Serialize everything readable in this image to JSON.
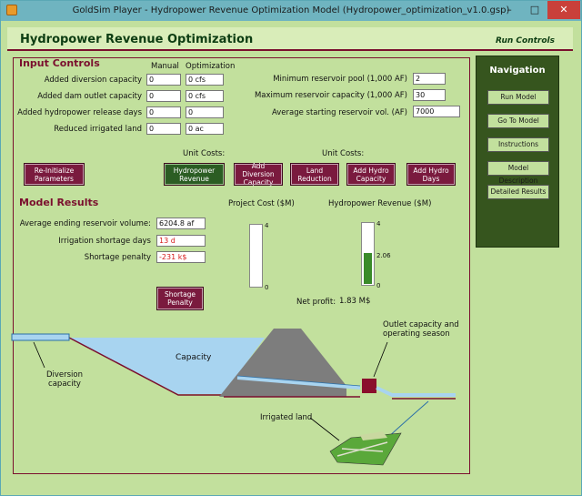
{
  "window": {
    "title": "GoldSim Player - Hydropower Revenue Optimization Model (Hydropower_optimization_v1.0.gsp)",
    "minimize": "–",
    "maximize": "□",
    "close": "✕"
  },
  "header": {
    "title": "Hydropower Revenue Optimization",
    "run_controls": "Run Controls"
  },
  "inputs": {
    "heading": "Input Controls",
    "col_manual": "Manual",
    "col_optimization": "Optimization",
    "rows": [
      {
        "label": "Added diversion capacity",
        "manual": "0",
        "opt": "0 cfs"
      },
      {
        "label": "Added dam outlet capacity",
        "manual": "0",
        "opt": "0 cfs"
      },
      {
        "label": "Added hydropower release days",
        "manual": "0",
        "opt": "0"
      },
      {
        "label": "Reduced irrigated land",
        "manual": "0",
        "opt": "0 ac"
      }
    ],
    "reservoir": [
      {
        "label": "Minimum reservoir pool (1,000 AF)",
        "value": "2"
      },
      {
        "label": "Maximum reservoir capacity (1,000 AF)",
        "value": "30"
      },
      {
        "label": "Average starting reservoir vol. (AF)",
        "value": "7000"
      }
    ]
  },
  "unit_costs": {
    "label1": "Unit Costs:",
    "label2": "Unit Costs:"
  },
  "buttons": {
    "reinit": "Re-Initialize Parameters",
    "hydro_rev": "Hydropower Revenue",
    "add_div": "Add Diversion Capacity",
    "land_red": "Land Reduction",
    "add_hydro_cap": "Add Hydro Capacity",
    "add_hydro_days": "Add Hydro Days",
    "shortage": "Shortage Penalty"
  },
  "results": {
    "heading": "Model Results",
    "rows": [
      {
        "label": "Average ending reservoir volume:",
        "value": "6204.8 af"
      },
      {
        "label": "Irrigation shortage days",
        "value": "13 d"
      },
      {
        "label": "Shortage penalty",
        "value": "-231 k$"
      }
    ],
    "project_cost_label": "Project Cost ($M)",
    "hydro_rev_label": "Hydropower Revenue ($M)",
    "project_cost": {
      "max": "4",
      "min": "0",
      "value": 0
    },
    "hydro_rev": {
      "max": "4",
      "min": "0",
      "value_label": "2.06",
      "value": 2.06
    },
    "net_profit_label": "Net profit:",
    "net_profit": "1.83 M$"
  },
  "diagram": {
    "capacity": "Capacity",
    "diversion": "Diversion capacity",
    "outlet": "Outlet capacity and operating season",
    "irrigated": "Irrigated land"
  },
  "navigation": {
    "title": "Navigation",
    "items": [
      "Run Model",
      "Go To Model",
      "Instructions",
      "Model Description",
      "Detailed Results"
    ]
  },
  "colors": {
    "accent": "#7a0f2e",
    "nav_bg": "#36551e",
    "panel_bg": "#c2e09d",
    "water": "#a8d4f0"
  }
}
